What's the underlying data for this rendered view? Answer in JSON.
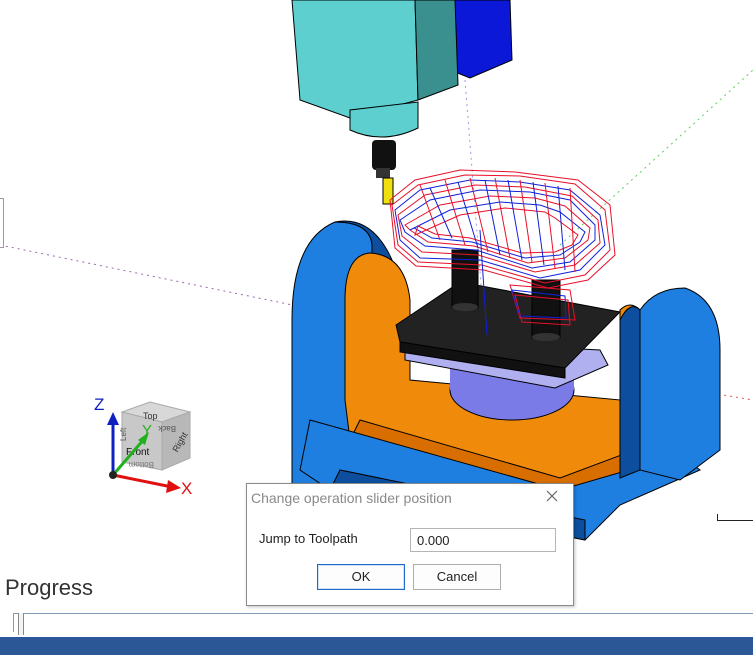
{
  "viewport": {
    "view_cube": {
      "axis_x": "X",
      "axis_y": "Y",
      "axis_z": "Z",
      "face_top": "Top",
      "face_front": "Front",
      "face_right": "Right",
      "face_back": "Back",
      "face_bottom": "Bottom",
      "face_left": "Left"
    },
    "colors": {
      "spindle": "#5ecfcf",
      "spindle_dark": "#3a8f8f",
      "trunnion": "#1e7fe0",
      "trunnion_dark": "#0d4f9e",
      "cradle_inner": "#f08a0a",
      "table": "#222222",
      "rotary": "#7b7be8",
      "toolpath_red": "#e8102a",
      "toolpath_blue": "#1020d8",
      "tool": "#f0e010"
    }
  },
  "dialog": {
    "title": "Change operation slider position",
    "jump_label": "Jump to Toolpath",
    "jump_value": "0.000",
    "ok_label": "OK",
    "cancel_label": "Cancel"
  },
  "progress": {
    "title": "Progress",
    "value": 0
  }
}
